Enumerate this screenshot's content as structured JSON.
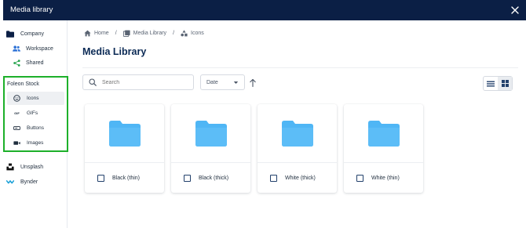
{
  "modal": {
    "title": "Media library",
    "close_icon": "close-icon"
  },
  "sidebar": {
    "company": {
      "label": "Company",
      "icon": "folder-icon"
    },
    "workspace": {
      "label": "Workspace",
      "icon": "people-icon"
    },
    "shared": {
      "label": "Shared",
      "icon": "share-icon"
    },
    "stock": {
      "label": "Foleon Stock",
      "items": [
        {
          "label": "Icons",
          "icon": "smiley-icon",
          "active": true
        },
        {
          "label": "GIFs",
          "icon": "gif-icon",
          "active": false
        },
        {
          "label": "Buttons",
          "icon": "button-icon",
          "active": false
        },
        {
          "label": "Images",
          "icon": "video-icon",
          "active": false
        }
      ]
    },
    "unsplash": {
      "label": "Unsplash",
      "icon": "unsplash-icon"
    },
    "bynder": {
      "label": "Bynder",
      "icon": "bynder-icon"
    }
  },
  "breadcrumb": [
    {
      "label": "Home",
      "icon": "home-icon"
    },
    {
      "label": "Media Library",
      "icon": "library-icon"
    },
    {
      "label": "Icons",
      "icon": "shapes-icon"
    }
  ],
  "page": {
    "title": "Media Library"
  },
  "toolbar": {
    "search_placeholder": "Search",
    "sort_value": "Date",
    "sort_direction": "ascending",
    "view_mode": "grid"
  },
  "folders": [
    {
      "name": "Black (thin)"
    },
    {
      "name": "Black (thick)"
    },
    {
      "name": "White (thick)"
    },
    {
      "name": "White (thin)"
    }
  ],
  "colors": {
    "header_bg": "#0b1f45",
    "folder": "#4fb6f5",
    "highlight": "#1db02a",
    "title": "#0b2a55"
  }
}
